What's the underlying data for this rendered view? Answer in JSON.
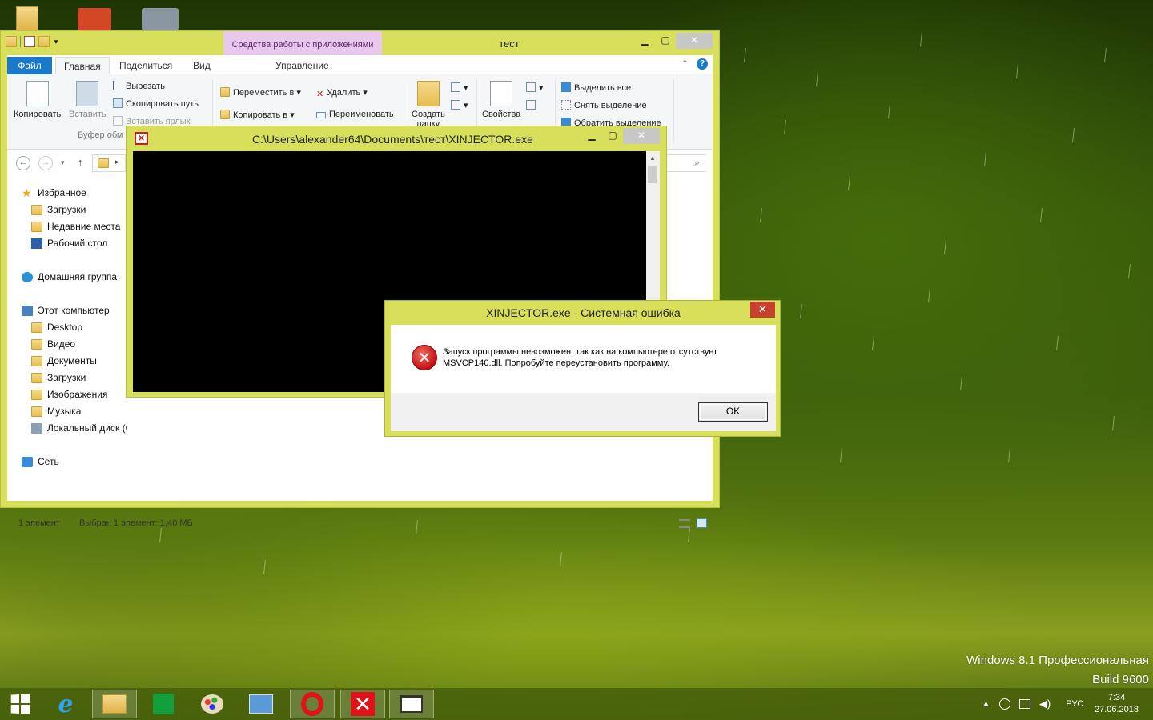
{
  "explorer": {
    "title": "тест",
    "context_tab_title": "Средства работы с приложениями",
    "tabs": [
      "Файл",
      "Главная",
      "Поделиться",
      "Вид",
      "Управление"
    ],
    "ribbon": {
      "copy": "Копировать",
      "paste": "Вставить",
      "cut": "Вырезать",
      "copy_path": "Скопировать путь",
      "paste_shortcut": "Вставить ярлык",
      "clipboard_group": "Буфер обм",
      "move_to": "Переместить в",
      "copy_to": "Копировать в",
      "delete": "Удалить",
      "rename": "Переименовать",
      "new_folder_line1": "Создать",
      "new_folder_line2": "папку",
      "properties": "Свойства",
      "select_all": "Выделить все",
      "select_none": "Снять выделение",
      "invert_selection": "Обратить выделение"
    },
    "nav": {
      "favorites": "Избранное",
      "downloads": "Загрузки",
      "recent": "Недавние места",
      "desktop": "Рабочий стол",
      "homegroup": "Домашняя группа",
      "this_pc": "Этот компьютер",
      "pc_desktop": "Desktop",
      "video": "Видео",
      "documents": "Документы",
      "pc_downloads": "Загрузки",
      "pictures": "Изображения",
      "music": "Музыка",
      "local_disk": "Локальный диск (C",
      "network": "Сеть"
    },
    "status": {
      "count": "1 элемент",
      "selected": "Выбран 1 элемент: 1,40 МБ"
    }
  },
  "console": {
    "title": "C:\\Users\\alexander64\\Documents\\тест\\XINJECTOR.exe",
    "icon_glyph": "×"
  },
  "error_dialog": {
    "title": "XINJECTOR.exe - Системная ошибка",
    "message_line1": "Запуск программы невозможен, так как на компьютере отсутствует",
    "message_line2": "MSVCP140.dll. Попробуйте переустановить программу.",
    "ok": "OK",
    "close_glyph": "✕",
    "icon_glyph": "✕"
  },
  "watermark": {
    "line1": "Windows 8.1 Профессиональная",
    "line2": "Build 9600"
  },
  "taskbar": {
    "lang": "РУС",
    "time": "7:34",
    "date": "27.06.2018",
    "apps": [
      "start-icon",
      "internet-explorer-icon",
      "file-explorer-icon",
      "store-icon",
      "paint-icon",
      "remote-desktop-icon",
      "opera-icon",
      "xinjector-icon",
      "console-window-icon"
    ]
  },
  "colors": {
    "window_frame": "#d8e05b",
    "file_tab": "#1979ca",
    "context_tab": "#e9c8ee",
    "error_red": "#c41414"
  }
}
